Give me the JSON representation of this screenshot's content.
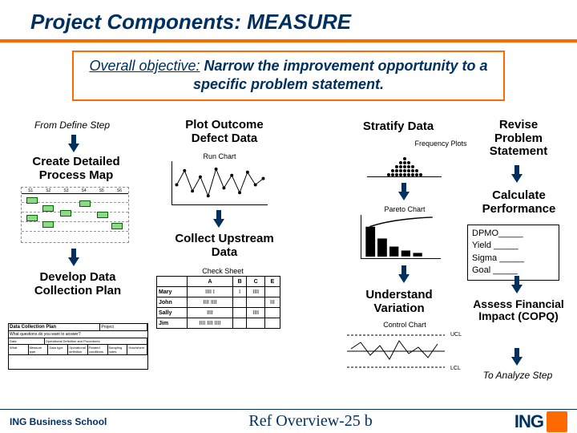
{
  "title": "Project Components: MEASURE",
  "objective": {
    "label": "Overall objective:",
    "text": "Narrow the improvement opportunity to a specific problem statement."
  },
  "col1": {
    "from": "From Define Step",
    "create_map": "Create Detailed Process Map",
    "develop_plan": "Develop Data Collection Plan",
    "plan_title": "Data Collection Plan",
    "plan_q": "What questions do you want to answer?"
  },
  "col2": {
    "plot": "Plot Outcome Defect Data",
    "run_chart": "Run Chart",
    "collect": "Collect Upstream Data",
    "check_sheet": "Check Sheet",
    "cols": [
      "",
      "A",
      "B",
      "C",
      "E"
    ],
    "rows": [
      {
        "name": "Mary",
        "a": "IIII I",
        "b": "I",
        "c": "IIII",
        "e": ""
      },
      {
        "name": "John",
        "a": "IIII IIII",
        "b": "",
        "c": "",
        "e": "III"
      },
      {
        "name": "Sally",
        "a": "IIII",
        "b": "",
        "c": "IIII",
        "e": ""
      },
      {
        "name": "Jim",
        "a": "IIII IIII IIII",
        "b": "",
        "c": "",
        "e": ""
      }
    ]
  },
  "col3": {
    "stratify": "Stratify Data",
    "freq": "Frequency Plots",
    "pareto": "Pareto Chart",
    "understand": "Understand Variation",
    "control": "Control Chart",
    "ucl": "UCL",
    "lcl": "LCL"
  },
  "col4": {
    "revise": "Revise Problem Statement",
    "calc": "Calculate Performance",
    "metrics": {
      "dpmo": "DPMO_____",
      "yield": "Yield  _____",
      "sigma": "Sigma _____",
      "goal": "Goal   _____"
    },
    "assess": "Assess Financial Impact (COPQ)",
    "to_analyze": "To Analyze Step"
  },
  "footer": {
    "school": "ING Business School",
    "ref": "Ref Overview-25 b",
    "logo": "ING"
  }
}
